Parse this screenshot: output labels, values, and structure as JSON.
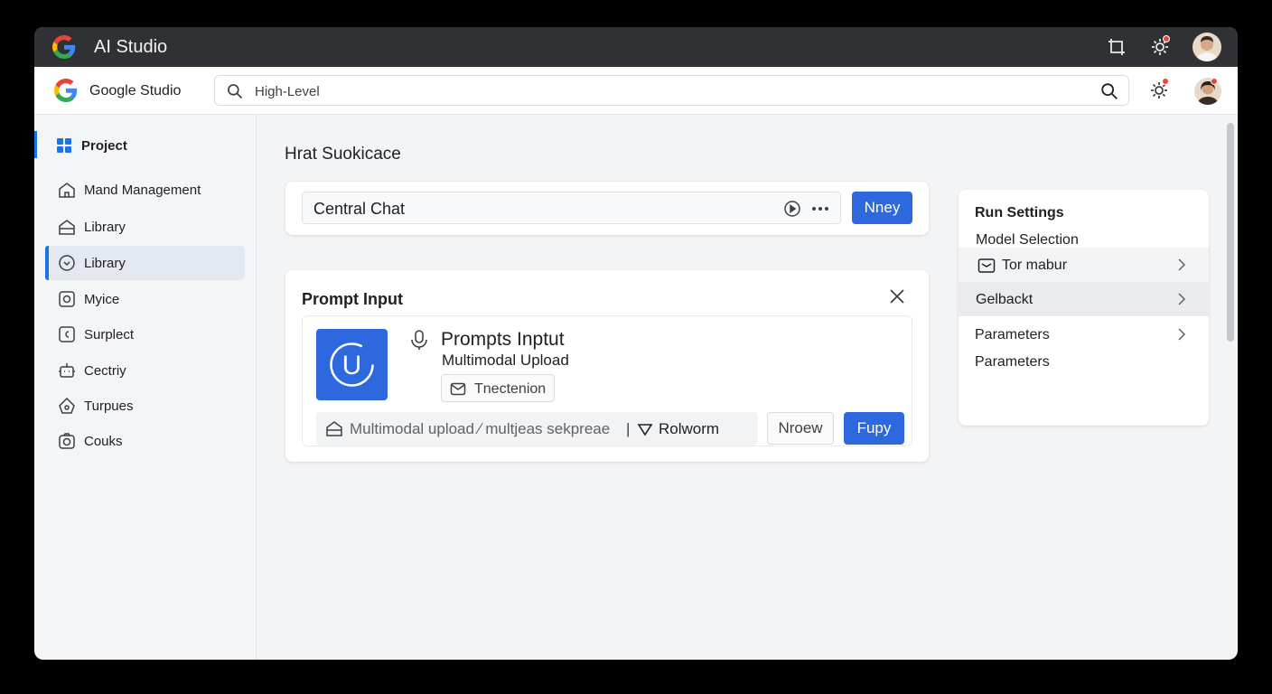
{
  "titlebar": {
    "title": "AI Studio"
  },
  "header": {
    "brand": "Google Studio",
    "search_value": "High-Level"
  },
  "sidebar": {
    "project_label": "Project",
    "items": [
      {
        "label": "Mand Management",
        "icon": "home-icon"
      },
      {
        "label": "Library",
        "icon": "home-icon"
      },
      {
        "label": "Library",
        "icon": "chevron-circle-icon",
        "active": true
      },
      {
        "label": "Myice",
        "icon": "camera-icon"
      },
      {
        "label": "Surplect",
        "icon": "square-icon"
      },
      {
        "label": "Cectriy",
        "icon": "robot-icon"
      },
      {
        "label": "Turpues",
        "icon": "home-icon"
      },
      {
        "label": "Couks",
        "icon": "camera-icon"
      }
    ]
  },
  "main": {
    "title": "Hrat Suokicace",
    "chat": {
      "value": "Central Chat",
      "button_label": "Nney"
    },
    "prompt": {
      "title": "Prompt Input",
      "heading": "Prompts Inptut",
      "subheading": "Multimodal Upload",
      "chip_label": "Tnectenion",
      "upload_tile_letter": "U",
      "bottom_text": "Multimodal upload ∕ multjeas sekpreae",
      "bottom_separator": "|",
      "bottom_tail": "Rolworm",
      "outline_button": "Nroew",
      "primary_button": "Fupy"
    }
  },
  "run_settings": {
    "title": "Run Settings",
    "subtitle": "Model Selection",
    "rows": [
      {
        "label": "Tor mabur",
        "has_icon": true
      },
      {
        "label": "Gelbackt",
        "has_icon": false
      },
      {
        "label": "Parameters",
        "has_icon": false
      }
    ],
    "footer": "Parameters"
  },
  "colors": {
    "accent": "#2d68df",
    "titlebar": "#303134",
    "notification": "#e8453c"
  }
}
